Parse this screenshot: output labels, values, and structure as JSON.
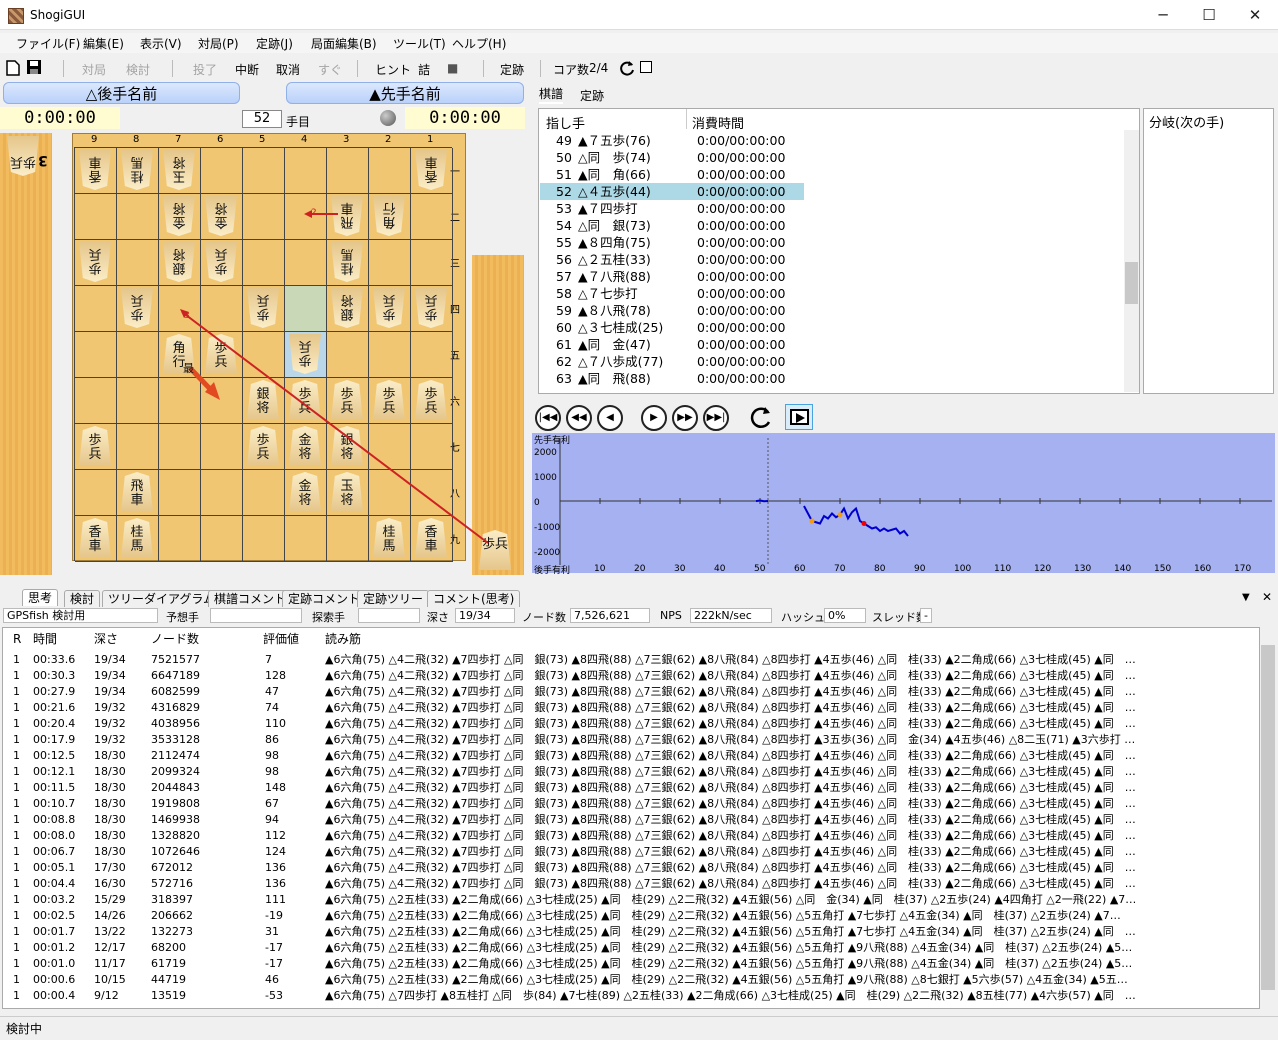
{
  "window": {
    "title": "ShogiGUI",
    "minimize": "─",
    "maximize": "☐",
    "close": "✕"
  },
  "menu": [
    "ファイル(F)",
    "編集(E)",
    "表示(V)",
    "対局(P)",
    "定跡(J)",
    "局面編集(B)",
    "ツール(T)",
    "ヘルプ(H)"
  ],
  "toolbar": {
    "taikyoku": "対局",
    "kento": "検討",
    "toryo": "投了",
    "chudan": "中断",
    "torikeshi": "取消",
    "sugu": "すぐ",
    "hint": "ヒント",
    "tsume": "詰",
    "stop": "■",
    "joseki": "定跡",
    "core_label": "コア数",
    "core_value": "2/4"
  },
  "players": {
    "gote": "△後手名前",
    "sente": "▲先手名前"
  },
  "clocks": {
    "gote": "0:00:00",
    "sente": "0:00:00"
  },
  "move_number": {
    "value": "52",
    "suffix": "手目"
  },
  "board": {
    "files": [
      "9",
      "8",
      "7",
      "6",
      "5",
      "4",
      "3",
      "2",
      "1"
    ],
    "ranks": [
      "一",
      "二",
      "三",
      "四",
      "五",
      "六",
      "七",
      "八",
      "九"
    ],
    "pieces": [
      {
        "f": 9,
        "r": 1,
        "t": "香車",
        "gote": true
      },
      {
        "f": 8,
        "r": 1,
        "t": "桂馬",
        "gote": true
      },
      {
        "f": 7,
        "r": 1,
        "t": "玉将",
        "gote": true
      },
      {
        "f": 1,
        "r": 1,
        "t": "香車",
        "gote": true
      },
      {
        "f": 7,
        "r": 2,
        "t": "金将",
        "gote": true
      },
      {
        "f": 6,
        "r": 2,
        "t": "金将",
        "gote": true
      },
      {
        "f": 3,
        "r": 2,
        "t": "飛車",
        "gote": true
      },
      {
        "f": 2,
        "r": 2,
        "t": "角行",
        "gote": true
      },
      {
        "f": 9,
        "r": 3,
        "t": "歩兵",
        "gote": true
      },
      {
        "f": 7,
        "r": 3,
        "t": "銀将",
        "gote": true
      },
      {
        "f": 6,
        "r": 3,
        "t": "歩兵",
        "gote": true
      },
      {
        "f": 3,
        "r": 3,
        "t": "桂馬",
        "gote": true
      },
      {
        "f": 8,
        "r": 4,
        "t": "歩兵",
        "gote": true
      },
      {
        "f": 5,
        "r": 4,
        "t": "歩兵",
        "gote": true
      },
      {
        "f": 3,
        "r": 4,
        "t": "銀将",
        "gote": true
      },
      {
        "f": 2,
        "r": 4,
        "t": "歩兵",
        "gote": true
      },
      {
        "f": 1,
        "r": 4,
        "t": "歩兵",
        "gote": true
      },
      {
        "f": 7,
        "r": 5,
        "t": "角行",
        "gote": false
      },
      {
        "f": 6,
        "r": 5,
        "t": "歩兵",
        "gote": false
      },
      {
        "f": 4,
        "r": 5,
        "t": "歩兵",
        "gote": true
      },
      {
        "f": 5,
        "r": 6,
        "t": "銀将",
        "gote": false
      },
      {
        "f": 4,
        "r": 6,
        "t": "歩兵",
        "gote": false
      },
      {
        "f": 3,
        "r": 6,
        "t": "歩兵",
        "gote": false
      },
      {
        "f": 2,
        "r": 6,
        "t": "歩兵",
        "gote": false
      },
      {
        "f": 1,
        "r": 6,
        "t": "歩兵",
        "gote": false
      },
      {
        "f": 9,
        "r": 7,
        "t": "歩兵",
        "gote": false
      },
      {
        "f": 5,
        "r": 7,
        "t": "歩兵",
        "gote": false
      },
      {
        "f": 4,
        "r": 7,
        "t": "金将",
        "gote": false
      },
      {
        "f": 3,
        "r": 7,
        "t": "銀将",
        "gote": false
      },
      {
        "f": 8,
        "r": 8,
        "t": "飛車",
        "gote": false
      },
      {
        "f": 4,
        "r": 8,
        "t": "金将",
        "gote": false
      },
      {
        "f": 3,
        "r": 8,
        "t": "玉将",
        "gote": false
      },
      {
        "f": 9,
        "r": 9,
        "t": "香車",
        "gote": false
      },
      {
        "f": 8,
        "r": 9,
        "t": "桂馬",
        "gote": false
      },
      {
        "f": 2,
        "r": 9,
        "t": "桂馬",
        "gote": false
      },
      {
        "f": 1,
        "r": 9,
        "t": "香車",
        "gote": false
      }
    ],
    "arrow_labels": {
      "a": "2",
      "b": "3",
      "best": "最"
    }
  },
  "hands": {
    "gote_piece": "歩兵",
    "gote_count": "3",
    "sente_piece": "歩兵"
  },
  "kifu_tabs": {
    "kifu": "棋譜",
    "joseki": "定跡"
  },
  "kifu_header": {
    "move": "指し手",
    "time": "消費時間"
  },
  "kifu": [
    {
      "n": "49",
      "m": "▲７五歩(76)",
      "t": "0:00/00:00:00"
    },
    {
      "n": "50",
      "m": "△同　歩(74)",
      "t": "0:00/00:00:00"
    },
    {
      "n": "51",
      "m": "▲同　角(66)",
      "t": "0:00/00:00:00"
    },
    {
      "n": "52",
      "m": "△４五歩(44)",
      "t": "0:00/00:00:00"
    },
    {
      "n": "53",
      "m": "▲７四歩打",
      "t": "0:00/00:00:00"
    },
    {
      "n": "54",
      "m": "△同　銀(73)",
      "t": "0:00/00:00:00"
    },
    {
      "n": "55",
      "m": "▲８四角(75)",
      "t": "0:00/00:00:00"
    },
    {
      "n": "56",
      "m": "△２五桂(33)",
      "t": "0:00/00:00:00"
    },
    {
      "n": "57",
      "m": "▲７八飛(88)",
      "t": "0:00/00:00:00"
    },
    {
      "n": "58",
      "m": "△７七歩打",
      "t": "0:00/00:00:00"
    },
    {
      "n": "59",
      "m": "▲８八飛(78)",
      "t": "0:00/00:00:00"
    },
    {
      "n": "60",
      "m": "△３七桂成(25)",
      "t": "0:00/00:00:00"
    },
    {
      "n": "61",
      "m": "▲同　金(47)",
      "t": "0:00/00:00:00"
    },
    {
      "n": "62",
      "m": "△７八歩成(77)",
      "t": "0:00/00:00:00"
    },
    {
      "n": "63",
      "m": "▲同　飛(88)",
      "t": "0:00/00:00:00"
    }
  ],
  "branch_header": "分岐(次の手)",
  "graph": {
    "top_label": "先手有利",
    "bottom_label": "後手有利",
    "yticks": [
      "2000",
      "1000",
      "0",
      "-1000",
      "-2000"
    ],
    "xticks": [
      "10",
      "20",
      "30",
      "40",
      "50",
      "60",
      "70",
      "80",
      "90",
      "100",
      "110",
      "120",
      "130",
      "140",
      "150",
      "160",
      "170"
    ],
    "bg": "#a6b1f2",
    "line": "#0000cc"
  },
  "bottom_tabs": [
    "思考",
    "検討",
    "ツリーダイアグラム",
    "棋譜コメント",
    "定跡コメント",
    "定跡ツリー",
    "コメント(思考)"
  ],
  "engine_status": {
    "engine": "GPSfish 検討用",
    "yoso_label": "予想手",
    "tansaku_label": "探索手",
    "depth_label": "深さ",
    "depth": "19/34",
    "nodes_label": "ノード数",
    "nodes": "7,526,621",
    "nps_label": "NPS",
    "nps": "222kN/sec",
    "hash_label": "ハッシュ",
    "hash": "0%",
    "thread_label": "スレッド数",
    "thread": "-"
  },
  "pv_header": {
    "r": "R",
    "time": "時間",
    "depth": "深さ",
    "nodes": "ノード数",
    "score": "評価値",
    "pv": "読み筋"
  },
  "pv_rows": [
    {
      "r": "1",
      "time": "00:33.6",
      "depth": "19/34",
      "nodes": "7521577",
      "score": "7",
      "pv": "▲6六角(75) △4二飛(32) ▲7四歩打 △同　銀(73) ▲8四飛(88) △7三銀(62) ▲8八飛(84) △8四歩打 ▲4五歩(46) △同　桂(33) ▲2二角成(66) △3七桂成(45) ▲同　…"
    },
    {
      "r": "1",
      "time": "00:30.3",
      "depth": "19/34",
      "nodes": "6647189",
      "score": "128",
      "pv": "▲6六角(75) △4二飛(32) ▲7四歩打 △同　銀(73) ▲8四飛(88) △7三銀(62) ▲8八飛(84) △8四歩打 ▲4五歩(46) △同　桂(33) ▲2二角成(66) △3七桂成(45) ▲同　…"
    },
    {
      "r": "1",
      "time": "00:27.9",
      "depth": "19/34",
      "nodes": "6082599",
      "score": "47",
      "pv": "▲6六角(75) △4二飛(32) ▲7四歩打 △同　銀(73) ▲8四飛(88) △7三銀(62) ▲8八飛(84) △8四歩打 ▲4五歩(46) △同　桂(33) ▲2二角成(66) △3七桂成(45) ▲同　…"
    },
    {
      "r": "1",
      "time": "00:21.6",
      "depth": "19/32",
      "nodes": "4316829",
      "score": "74",
      "pv": "▲6六角(75) △4二飛(32) ▲7四歩打 △同　銀(73) ▲8四飛(88) △7三銀(62) ▲8八飛(84) △8四歩打 ▲4五歩(46) △同　桂(33) ▲2二角成(66) △3七桂成(45) ▲同　…"
    },
    {
      "r": "1",
      "time": "00:20.4",
      "depth": "19/32",
      "nodes": "4038956",
      "score": "110",
      "pv": "▲6六角(75) △4二飛(32) ▲7四歩打 △同　銀(73) ▲8四飛(88) △7三銀(62) ▲8八飛(84) △8四歩打 ▲4五歩(46) △同　桂(33) ▲2二角成(66) △3七桂成(45) ▲同　…"
    },
    {
      "r": "1",
      "time": "00:17.9",
      "depth": "19/32",
      "nodes": "3533128",
      "score": "86",
      "pv": "▲6六角(75) △4二飛(32) ▲7四歩打 △同　銀(73) ▲8四飛(88) △7三銀(62) ▲8八飛(84) △8四歩打 ▲3五歩(36) △同　金(34) ▲4五歩(46) △8二玉(71) ▲3六歩打 …"
    },
    {
      "r": "1",
      "time": "00:12.5",
      "depth": "18/30",
      "nodes": "2112474",
      "score": "98",
      "pv": "▲6六角(75) △4二飛(32) ▲7四歩打 △同　銀(73) ▲8四飛(88) △7三銀(62) ▲8八飛(84) △8四歩打 ▲4五歩(46) △同　桂(33) ▲2二角成(66) △3七桂成(45) ▲同　…"
    },
    {
      "r": "1",
      "time": "00:12.1",
      "depth": "18/30",
      "nodes": "2099324",
      "score": "98",
      "pv": "▲6六角(75) △4二飛(32) ▲7四歩打 △同　銀(73) ▲8四飛(88) △7三銀(62) ▲8八飛(84) △8四歩打 ▲4五歩(46) △同　桂(33) ▲2二角成(66) △3七桂成(45) ▲同　…"
    },
    {
      "r": "1",
      "time": "00:11.5",
      "depth": "18/30",
      "nodes": "2044843",
      "score": "148",
      "pv": "▲6六角(75) △4二飛(32) ▲7四歩打 △同　銀(73) ▲8四飛(88) △7三銀(62) ▲8八飛(84) △8四歩打 ▲4五歩(46) △同　桂(33) ▲2二角成(66) △3七桂成(45) ▲同　…"
    },
    {
      "r": "1",
      "time": "00:10.7",
      "depth": "18/30",
      "nodes": "1919808",
      "score": "67",
      "pv": "▲6六角(75) △4二飛(32) ▲7四歩打 △同　銀(73) ▲8四飛(88) △7三銀(62) ▲8八飛(84) △8四歩打 ▲4五歩(46) △同　桂(33) ▲2二角成(66) △3七桂成(45) ▲同　…"
    },
    {
      "r": "1",
      "time": "00:08.8",
      "depth": "18/30",
      "nodes": "1469938",
      "score": "94",
      "pv": "▲6六角(75) △4二飛(32) ▲7四歩打 △同　銀(73) ▲8四飛(88) △7三銀(62) ▲8八飛(84) △8四歩打 ▲4五歩(46) △同　桂(33) ▲2二角成(66) △3七桂成(45) ▲同　…"
    },
    {
      "r": "1",
      "time": "00:08.0",
      "depth": "18/30",
      "nodes": "1328820",
      "score": "112",
      "pv": "▲6六角(75) △4二飛(32) ▲7四歩打 △同　銀(73) ▲8四飛(88) △7三銀(62) ▲8八飛(84) △8四歩打 ▲4五歩(46) △同　桂(33) ▲2二角成(66) △3七桂成(45) ▲同　…"
    },
    {
      "r": "1",
      "time": "00:06.7",
      "depth": "18/30",
      "nodes": "1072646",
      "score": "124",
      "pv": "▲6六角(75) △4二飛(32) ▲7四歩打 △同　銀(73) ▲8四飛(88) △7三銀(62) ▲8八飛(84) △8四歩打 ▲4五歩(46) △同　桂(33) ▲2二角成(66) △3七桂成(45) ▲同　…"
    },
    {
      "r": "1",
      "time": "00:05.1",
      "depth": "17/30",
      "nodes": "672012",
      "score": "136",
      "pv": "▲6六角(75) △4二飛(32) ▲7四歩打 △同　銀(73) ▲8四飛(88) △7三銀(62) ▲8八飛(84) △8四歩打 ▲4五歩(46) △同　桂(33) ▲2二角成(66) △3七桂成(45) ▲同　…"
    },
    {
      "r": "1",
      "time": "00:04.4",
      "depth": "16/30",
      "nodes": "572716",
      "score": "136",
      "pv": "▲6六角(75) △4二飛(32) ▲7四歩打 △同　銀(73) ▲8四飛(88) △7三銀(62) ▲8八飛(84) △8四歩打 ▲4五歩(46) △同　桂(33) ▲2二角成(66) △3七桂成(45) ▲同　…"
    },
    {
      "r": "1",
      "time": "00:03.2",
      "depth": "15/29",
      "nodes": "318397",
      "score": "111",
      "pv": "▲6六角(75) △2五桂(33) ▲2二角成(66) △3七桂成(25) ▲同　桂(29) △2二飛(32) ▲4五銀(56) △同　金(34) ▲同　桂(37) △2五歩(24) ▲4四角打 △2一飛(22) ▲7…"
    },
    {
      "r": "1",
      "time": "00:02.5",
      "depth": "14/26",
      "nodes": "206662",
      "score": "-19",
      "pv": "▲6六角(75) △2五桂(33) ▲2二角成(66) △3七桂成(25) ▲同　桂(29) △2二飛(32) ▲4五銀(56) △5五角打 ▲7七歩打 △4五金(34) ▲同　桂(37) △2五歩(24) ▲7…"
    },
    {
      "r": "1",
      "time": "00:01.7",
      "depth": "13/22",
      "nodes": "132273",
      "score": "31",
      "pv": "▲6六角(75) △2五桂(33) ▲2二角成(66) △3七桂成(25) ▲同　桂(29) △2二飛(32) ▲4五銀(56) △5五角打 ▲7七歩打 △4五金(34) ▲同　桂(37) △2五歩(24) ▲同　…"
    },
    {
      "r": "1",
      "time": "00:01.2",
      "depth": "12/17",
      "nodes": "68200",
      "score": "-17",
      "pv": "▲6六角(75) △2五桂(33) ▲2二角成(66) △3七桂成(25) ▲同　桂(29) △2二飛(32) ▲4五銀(56) △5五角打 ▲9八飛(88) △4五金(34) ▲同　桂(37) △2五歩(24) ▲5…"
    },
    {
      "r": "1",
      "time": "00:01.0",
      "depth": "11/17",
      "nodes": "61719",
      "score": "-17",
      "pv": "▲6六角(75) △2五桂(33) ▲2二角成(66) △3七桂成(25) ▲同　桂(29) △2二飛(32) ▲4五銀(56) △5五角打 ▲9八飛(88) △4五金(34) ▲同　桂(37) △2五歩(24) ▲5…"
    },
    {
      "r": "1",
      "time": "00:00.6",
      "depth": "10/15",
      "nodes": "44719",
      "score": "46",
      "pv": "▲6六角(75) △2五桂(33) ▲2二角成(66) △3七桂成(25) ▲同　桂(29) △2二飛(32) ▲4五銀(56) △5五角打 ▲9八飛(88) △8七銀打 ▲5六歩(57) △4五金(34) ▲5五…"
    },
    {
      "r": "1",
      "time": "00:00.4",
      "depth": "9/12",
      "nodes": "13519",
      "score": "-53",
      "pv": "▲6六角(75) △7四歩打 ▲8五桂打 △同　歩(84) ▲7七桂(89) △2五桂(33) ▲2二角成(66) △3七桂成(25) ▲同　桂(29) △2二飛(32) ▲8五桂(77) ▲4六歩(57) ▲同　…"
    }
  ],
  "statusbar": "検討中"
}
